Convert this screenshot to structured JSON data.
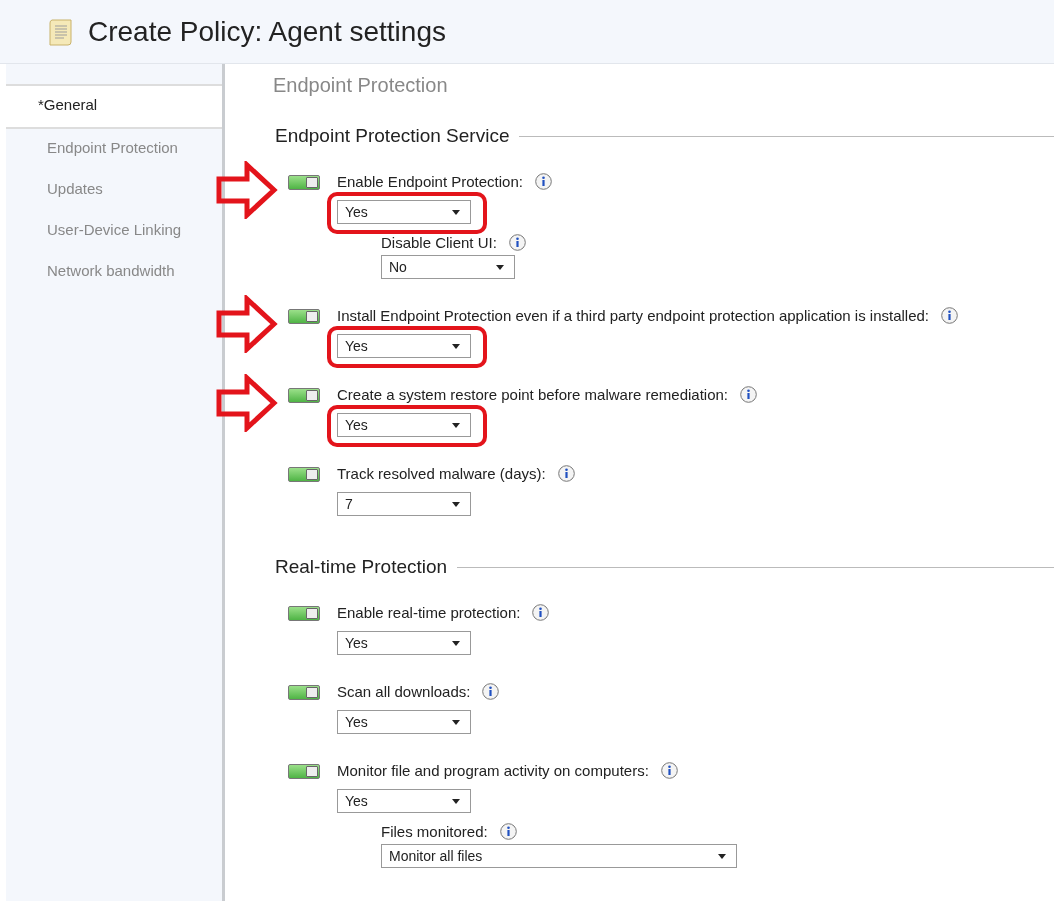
{
  "window": {
    "title": "Create Policy: Agent settings"
  },
  "sidebar": {
    "items": [
      {
        "label": "*General",
        "selected": true
      },
      {
        "label": "Endpoint Protection",
        "selected": false
      },
      {
        "label": "Updates",
        "selected": false
      },
      {
        "label": "User-Device Linking",
        "selected": false
      },
      {
        "label": "Network bandwidth",
        "selected": false
      }
    ]
  },
  "page": {
    "heading": "Endpoint Protection",
    "sections": [
      {
        "title": "Endpoint Protection Service",
        "settings": [
          {
            "label": "Enable Endpoint Protection:",
            "on": true,
            "value": "Yes",
            "highlighted": true,
            "children": [
              {
                "label": "Disable Client UI:",
                "value": "No",
                "wide": false
              }
            ]
          },
          {
            "label": "Install Endpoint Protection even if a third party endpoint protection application is installed:",
            "on": true,
            "value": "Yes",
            "highlighted": true
          },
          {
            "label": "Create a system restore point before malware remediation:",
            "on": true,
            "value": "Yes",
            "highlighted": true
          },
          {
            "label": "Track resolved malware (days):",
            "on": true,
            "value": "7",
            "highlighted": false
          }
        ]
      },
      {
        "title": "Real-time Protection",
        "settings": [
          {
            "label": "Enable real-time protection:",
            "on": true,
            "value": "Yes",
            "highlighted": false
          },
          {
            "label": "Scan all downloads:",
            "on": true,
            "value": "Yes",
            "highlighted": false
          },
          {
            "label": "Monitor file and program activity on computers:",
            "on": true,
            "value": "Yes",
            "highlighted": false,
            "children": [
              {
                "label": "Files monitored:",
                "value": "Monitor all files",
                "wide": true
              }
            ]
          }
        ]
      }
    ]
  }
}
